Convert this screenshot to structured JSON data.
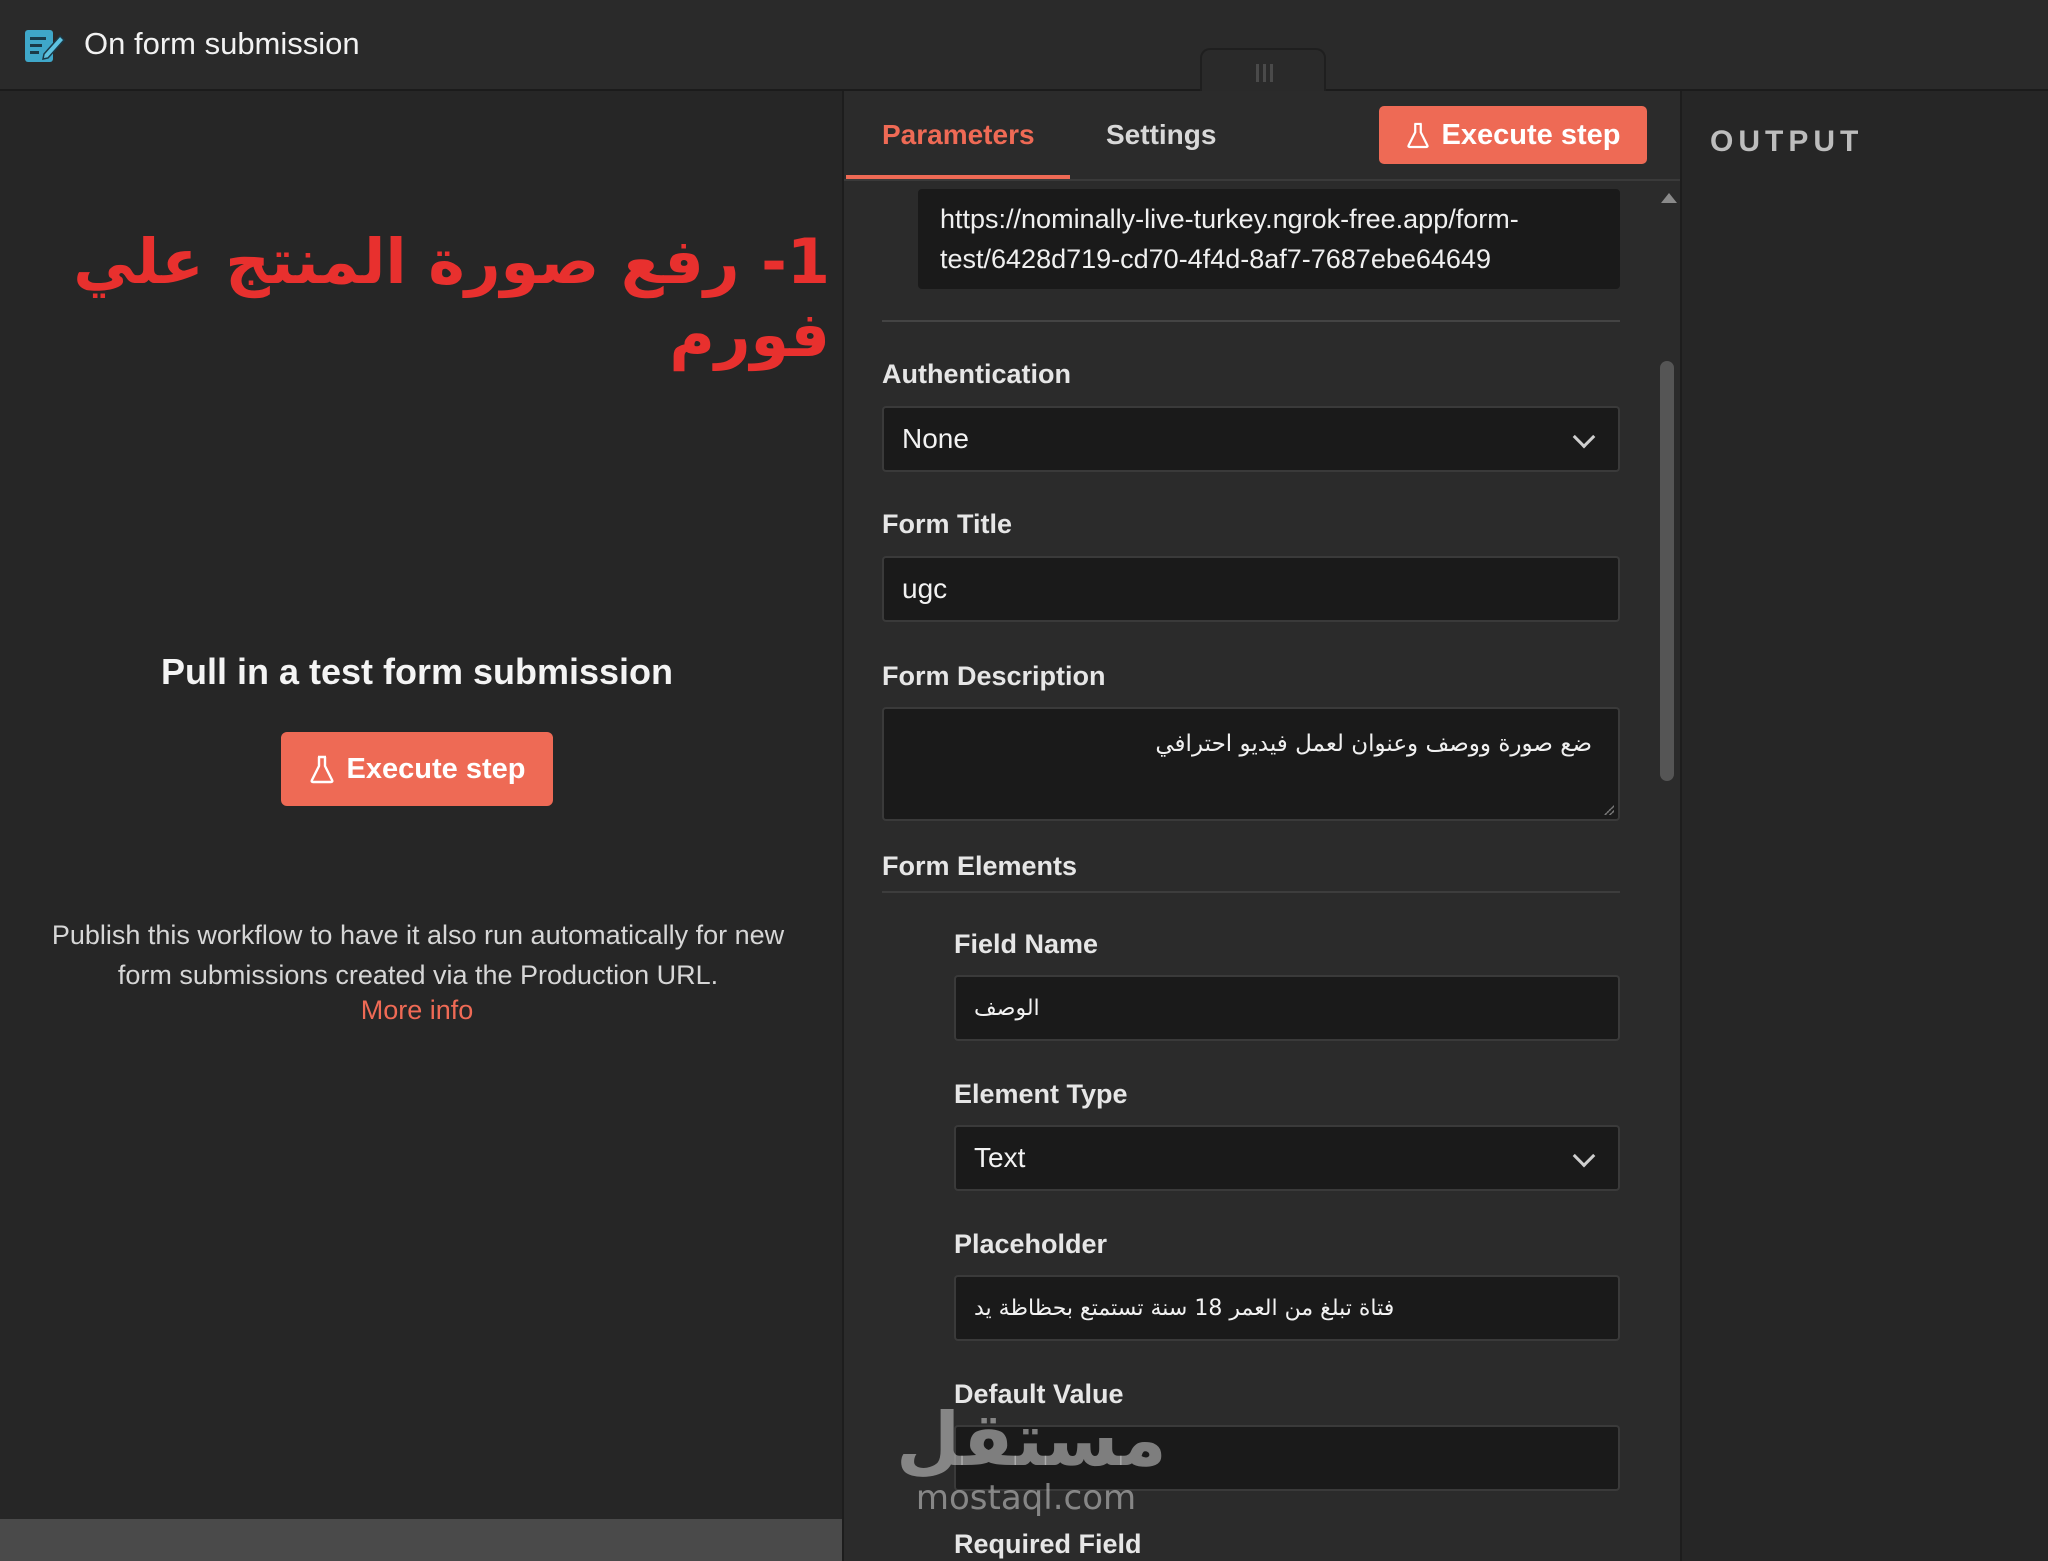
{
  "header": {
    "title": "On form submission",
    "icon": "form-edit-icon"
  },
  "left_panel": {
    "annotation": "1- رفع صورة المنتج علي فورم",
    "heading": "Pull in a test form submission",
    "execute_label": "Execute step",
    "publish_text": "Publish this workflow to have it also run automatically for new form submissions created via the Production URL.",
    "more_info": "More info"
  },
  "tabs": {
    "parameters": "Parameters",
    "settings": "Settings",
    "execute_label": "Execute step"
  },
  "params": {
    "url": "https://nominally-live-turkey.ngrok-free.app/form-test/6428d719-cd70-4f4d-8af7-7687ebe64649",
    "authentication_label": "Authentication",
    "authentication_value": "None",
    "form_title_label": "Form Title",
    "form_title_value": "ugc",
    "form_description_label": "Form Description",
    "form_description_value": "ضع صورة ووصف وعنوان لعمل فيديو احترافي",
    "form_elements_label": "Form Elements",
    "field_name_label": "Field Name",
    "field_name_value": "الوصف",
    "element_type_label": "Element Type",
    "element_type_value": "Text",
    "placeholder_label": "Placeholder",
    "placeholder_value": "فتاة تبلغ من العمر 18 سنة تستمتع بحظاظة يد",
    "default_value_label": "Default Value",
    "default_value_value": "",
    "required_field_label": "Required Field"
  },
  "watermark": {
    "arabic": "مستقل",
    "latin": "mostaql.com"
  },
  "output": {
    "title": "OUTPUT"
  },
  "colors": {
    "accent": "#ee6a55",
    "annotation_red": "#e8302e",
    "background": "#262626",
    "panel": "#2b2b2b",
    "input_bg": "#1a1a1a"
  }
}
